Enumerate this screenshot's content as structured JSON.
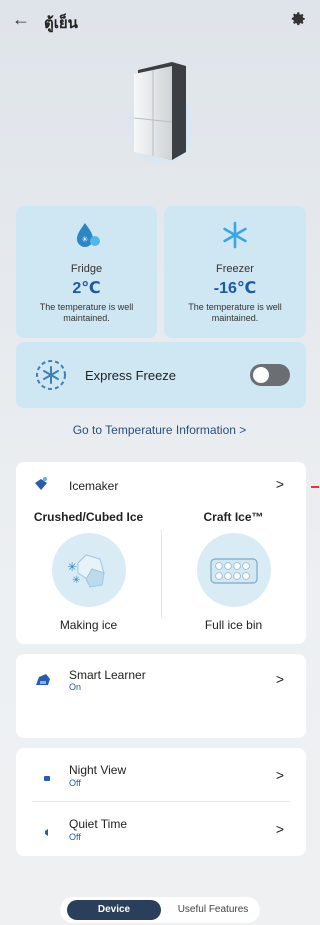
{
  "header": {
    "back_icon": "arrow-left-icon",
    "title": "ตู้เย็น",
    "settings_icon": "gear-icon"
  },
  "hero": {
    "image": "refrigerator-image"
  },
  "fridge": {
    "name": "Fridge",
    "temp": "2℃",
    "status": "The temperature is well maintained.",
    "icon": "water-drop-snowflake-icon"
  },
  "freezer": {
    "name": "Freezer",
    "temp": "-16℃",
    "status": "The temperature is well maintained.",
    "icon": "snowflake-icon"
  },
  "express_freeze": {
    "label": "Express Freeze",
    "enabled": false,
    "icon": "express-freeze-icon"
  },
  "temperature_link": {
    "label": "Go to Temperature Information >"
  },
  "icemaker": {
    "label": "Icemaker",
    "left": {
      "title": "Crushed/Cubed Ice",
      "status": "Making ice"
    },
    "right": {
      "title": "Craft Ice™",
      "status": "Full ice bin"
    }
  },
  "smart_learner": {
    "title": "Smart Learner",
    "sub": "On"
  },
  "night_view": {
    "title": "Night View",
    "sub": "Off"
  },
  "quiet_time": {
    "title": "Quiet Time",
    "sub": "Off"
  },
  "tabs": {
    "device": "Device",
    "useful": "Useful Features"
  },
  "colors": {
    "accent": "#1d5aa6",
    "tile_bg": "#cfe6f3",
    "tab_active": "#2a3f5c"
  }
}
